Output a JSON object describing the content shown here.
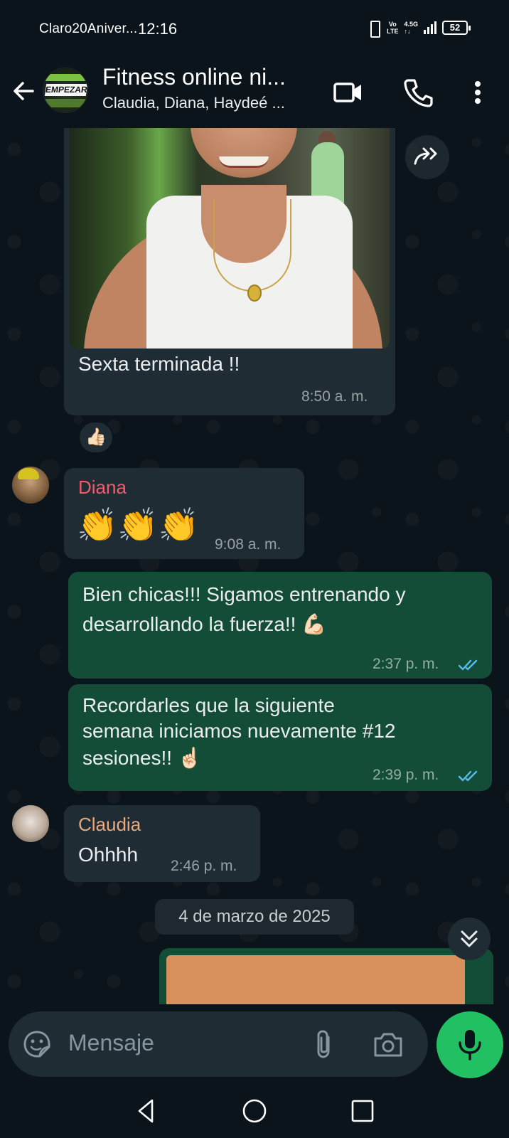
{
  "status_bar": {
    "carrier": "Claro20Aniver...",
    "time": "12:16",
    "volte_top": "Vo",
    "volte_bottom": "LTE",
    "network_top": "4.5G",
    "network_bottom": "↑↓",
    "battery": "52"
  },
  "header": {
    "back_icon": "arrow-left-icon",
    "group_name": "Fitness online  ni...",
    "members": "Claudia, Diana, Haydeé ...",
    "avatar_text": "EMPEZAR",
    "video_icon": "video-camera-icon",
    "call_icon": "phone-icon",
    "menu_icon": "more-vertical-icon"
  },
  "messages": [
    {
      "type": "incoming-image",
      "caption": "Sexta terminada !!",
      "time": "8:50 a. m.",
      "reaction": "👍🏻"
    },
    {
      "type": "incoming",
      "sender": "Diana",
      "sender_color": "#f15c6d",
      "text": "👏👏👏",
      "time": "9:08 a. m."
    },
    {
      "type": "outgoing",
      "text_line1": "Bien chicas!!! Sigamos entrenando y",
      "text_line2": "desarrollando la fuerza!! 💪🏻",
      "time": "2:37 p. m.",
      "status": "read"
    },
    {
      "type": "outgoing",
      "text_line1": "Recordarles que la siguiente",
      "text_line2": "semana iniciamos nuevamente #12",
      "text_line3": "sesiones!! ☝🏻",
      "time": "2:39 p. m.",
      "status": "read"
    },
    {
      "type": "incoming",
      "sender": "Claudia",
      "sender_color": "#e8a87c",
      "text": "Ohhhh",
      "time": "2:46 p. m."
    }
  ],
  "date_separator": "4 de marzo de 2025",
  "composer": {
    "placeholder": "Mensaje",
    "emoji_icon": "sticker-icon",
    "attach_icon": "paperclip-icon",
    "camera_icon": "camera-icon",
    "mic_icon": "microphone-icon"
  },
  "colors": {
    "background": "#0b141a",
    "incoming_bubble": "#202c33",
    "outgoing_bubble": "#144d37",
    "accent_green": "#21c063",
    "read_ticks": "#53bdeb"
  },
  "nav": {
    "back": "nav-back-icon",
    "home": "nav-home-icon",
    "recents": "nav-recents-icon"
  }
}
